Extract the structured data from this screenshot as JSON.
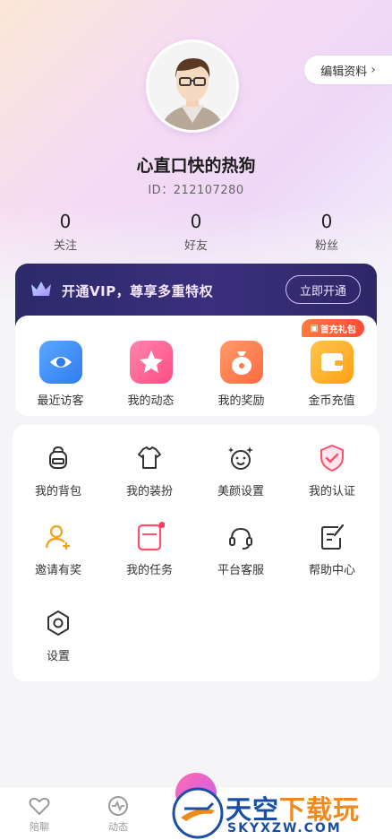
{
  "profile": {
    "edit_label": "编辑资料",
    "nickname": "心直口快的热狗",
    "id_text": "ID：212107280"
  },
  "stats": [
    {
      "value": "0",
      "label": "关注"
    },
    {
      "value": "0",
      "label": "好友"
    },
    {
      "value": "0",
      "label": "粉丝"
    }
  ],
  "vip": {
    "text": "开通VIP，尊享多重特权",
    "button": "立即开通"
  },
  "quick": {
    "promo_badge": "首充礼包",
    "items": [
      {
        "label": "最近访客",
        "icon": "eye-icon",
        "color": "#3d8df5"
      },
      {
        "label": "我的动态",
        "icon": "star-icon",
        "color": "#ff5c8e"
      },
      {
        "label": "我的奖励",
        "icon": "money-bag-icon",
        "color": "#ff7a4a"
      },
      {
        "label": "金币充值",
        "icon": "wallet-icon",
        "color": "#ffab1f"
      }
    ]
  },
  "menu": {
    "items": [
      {
        "label": "我的背包",
        "icon": "backpack-icon"
      },
      {
        "label": "我的装扮",
        "icon": "tshirt-icon"
      },
      {
        "label": "美颜设置",
        "icon": "beauty-face-icon"
      },
      {
        "label": "我的认证",
        "icon": "shield-check-icon"
      },
      {
        "label": "邀请有奖",
        "icon": "invite-user-icon"
      },
      {
        "label": "我的任务",
        "icon": "task-icon"
      },
      {
        "label": "平台客服",
        "icon": "headset-icon"
      },
      {
        "label": "帮助中心",
        "icon": "help-doc-icon"
      },
      {
        "label": "设置",
        "icon": "gear-icon"
      }
    ]
  },
  "tabbar": {
    "items": [
      {
        "label": "陪聊",
        "icon": "heart-icon"
      },
      {
        "label": "动态",
        "icon": "activity-icon"
      }
    ]
  },
  "watermark": {
    "title_a": "天空",
    "title_b": "下载玩",
    "sub": "SKYXZW.COM"
  }
}
